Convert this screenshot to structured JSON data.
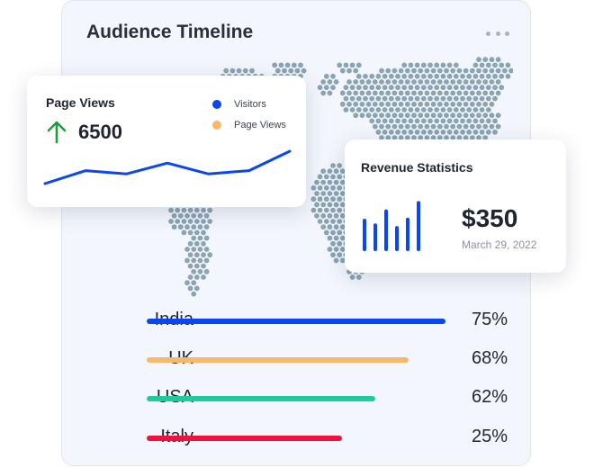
{
  "main": {
    "title": "Audience Timeline",
    "more_icon": "more-horizontal-icon"
  },
  "page_views": {
    "title": "Page Views",
    "value": "6500",
    "trend_icon": "arrow-up-icon",
    "trend_color": "#1f9d3a",
    "legend": [
      {
        "label": "Visitors",
        "color": "#0a47f0"
      },
      {
        "label": "Page Views",
        "color": "#f6b86a"
      }
    ],
    "series_color": "#0a47f0",
    "series": [
      10,
      34,
      28,
      48,
      28,
      34,
      70
    ]
  },
  "revenue": {
    "title": "Revenue Statistics",
    "amount": "$350",
    "date": "March 29, 2022",
    "bar_color": "#0a47f0",
    "bars": [
      0.62,
      0.53,
      0.8,
      0.48,
      0.64,
      0.96
    ]
  },
  "stats": [
    {
      "country": "India",
      "percent": "75%",
      "fraction": 1.0,
      "color": "#0a47f0"
    },
    {
      "country": "UK",
      "percent": "68%",
      "fraction": 0.875,
      "color": "#f6b86a"
    },
    {
      "country": "USA",
      "percent": "62%",
      "fraction": 0.765,
      "color": "#1fcaa0"
    },
    {
      "country": "Italy",
      "percent": "25%",
      "fraction": 0.655,
      "color": "#f0123e"
    }
  ],
  "map": {
    "dot_color": "#8aa4b4"
  }
}
